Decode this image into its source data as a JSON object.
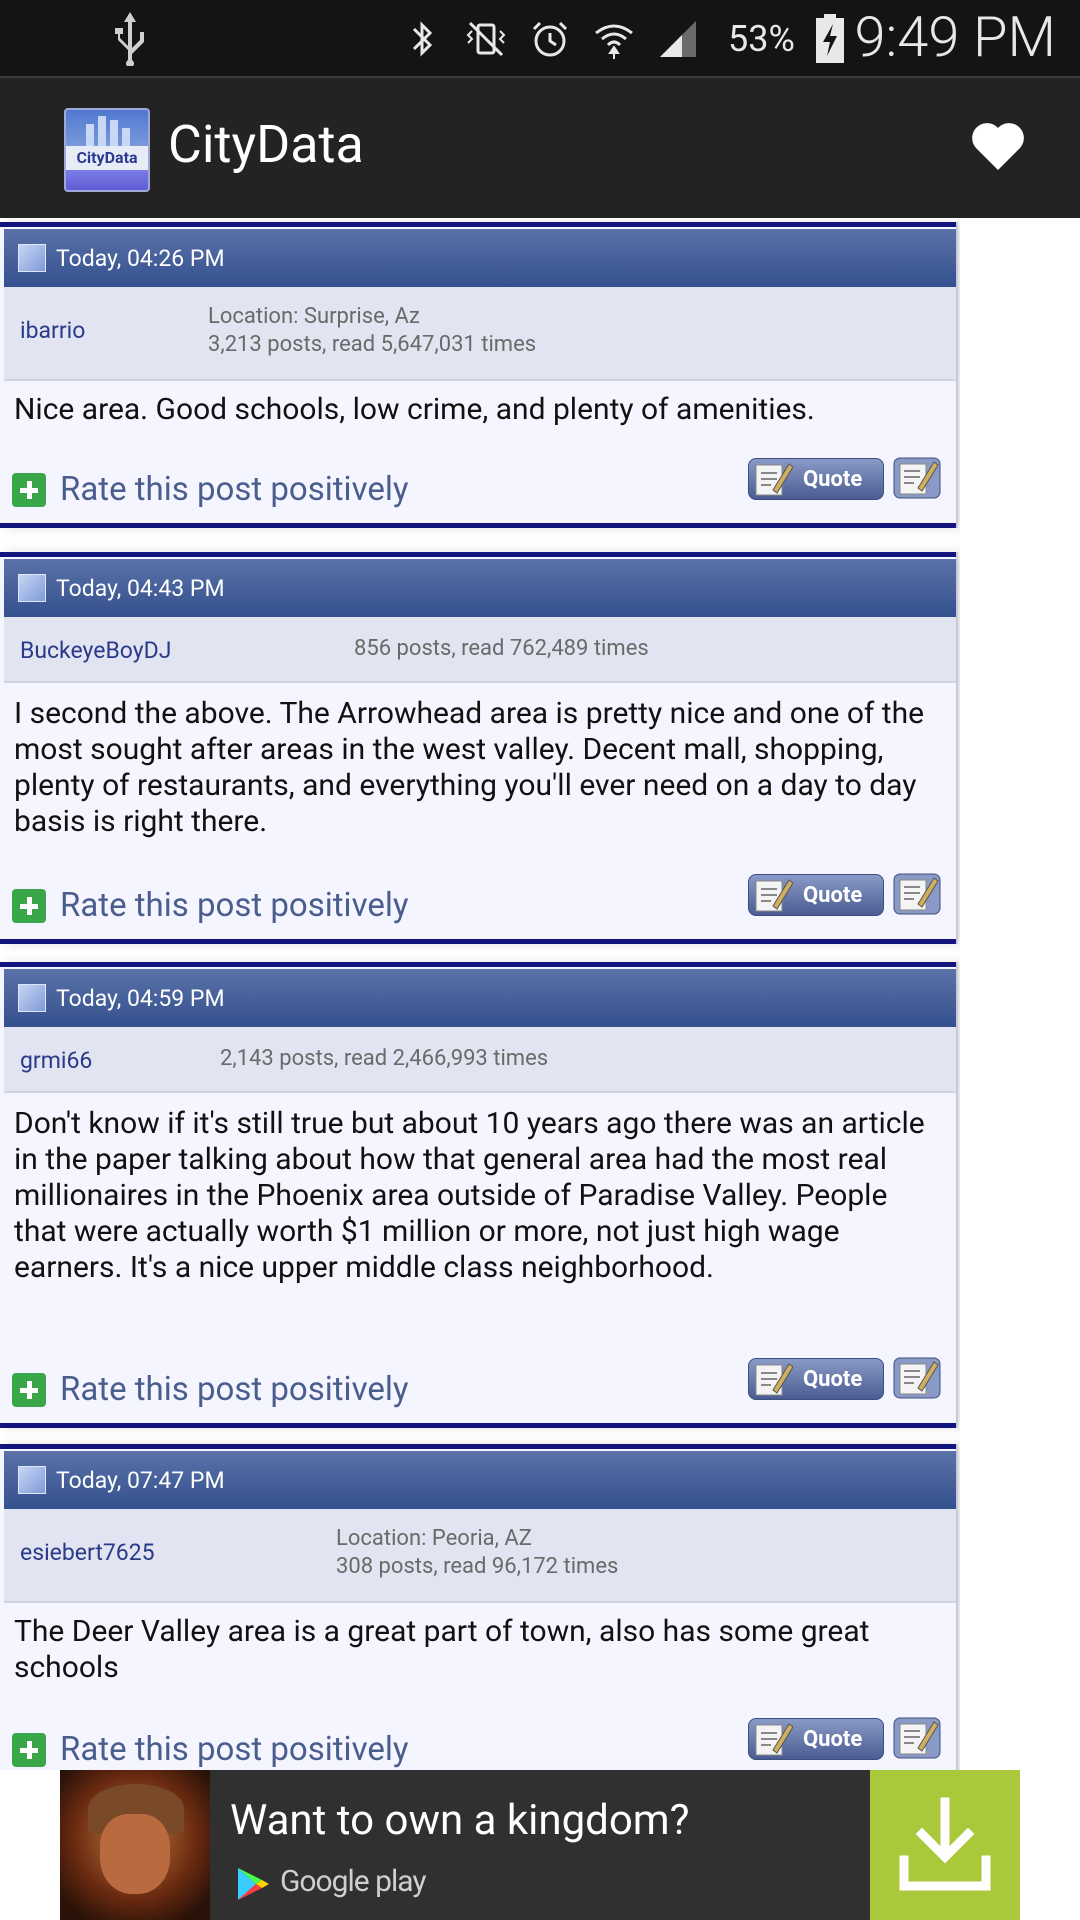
{
  "status_bar": {
    "battery_percent": "53%",
    "time": "9:49 PM",
    "icons": [
      "usb-icon",
      "bluetooth-icon",
      "vibrate-icon",
      "alarm-icon",
      "wifi-icon",
      "signal-icon",
      "battery-icon"
    ]
  },
  "app_bar": {
    "logo_text": "CityData",
    "title": "CityData",
    "favorite_icon": "heart-icon"
  },
  "posts": [
    {
      "date": "Today, 04:26 PM",
      "username": "ibarrio",
      "location": "Location: Surprise, Az",
      "stats": "3,213 posts, read 5,647,031 times",
      "body": "Nice area. Good schools, low crime, and plenty of amenities.",
      "rate_label": "Rate this post positively",
      "quote_label": "Quote"
    },
    {
      "date": "Today, 04:43 PM",
      "username": "BuckeyeBoyDJ",
      "location": "",
      "stats": "856 posts, read 762,489 times",
      "body": "I second the above. The Arrowhead area is pretty nice and one of the most sought after areas in the west valley. Decent mall, shopping, plenty of restaurants, and everything you'll ever need on a day to day basis is right there.",
      "rate_label": "Rate this post positively",
      "quote_label": "Quote"
    },
    {
      "date": "Today, 04:59 PM",
      "username": "grmi66",
      "location": "",
      "stats": "2,143 posts, read 2,466,993 times",
      "body": "Don't know if it's still true but about 10 years ago there was an article in the paper talking about how that general area had the most real millionaires in the Phoenix area outside of Paradise Valley. People that were actually worth $1 million or more, not just high wage earners. It's a nice upper middle class neighborhood.",
      "rate_label": "Rate this post positively",
      "quote_label": "Quote"
    },
    {
      "date": "Today, 07:47 PM",
      "username": "esiebert7625",
      "location": "Location: Peoria, AZ",
      "stats": "308 posts, read 96,172 times",
      "body": "The Deer Valley area is a great part of town, also has some great schools",
      "rate_label": "Rate this post positively",
      "quote_label": "Quote"
    }
  ],
  "ad": {
    "title": "Want to own a kingdom?",
    "store": "Google play",
    "download_icon": "download-icon"
  },
  "colors": {
    "app_bar": "#232323",
    "post_header": "#3d5793",
    "post_border": "#13157f",
    "post_bg": "#f5f5ff",
    "meta_bg": "#e2e4f1",
    "username": "#2a3a8a",
    "ad_download": "#a9c93a"
  }
}
